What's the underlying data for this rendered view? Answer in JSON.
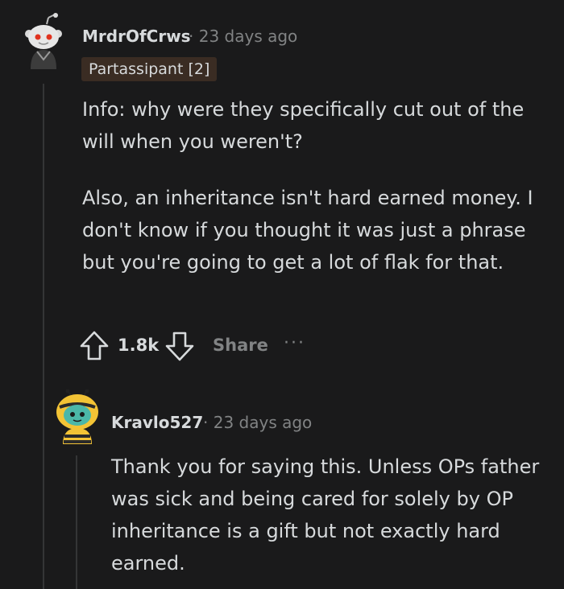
{
  "comment": {
    "username": "MrdrOfCrws",
    "separator": "·",
    "time": "23 days ago",
    "flair": "Partassipant [2]",
    "paragraphs": [
      "Info: why were they specifically cut out of the will when you weren't?",
      "Also, an inheritance isn't hard earned money. I don't know if you thought it was just a phrase but you're going to get a lot of flak for that."
    ],
    "votes": "1.8k",
    "share_label": "Share",
    "more_label": "···",
    "icons": {
      "avatar": "snoo-avatar-icon",
      "upvote": "upvote-arrow-icon",
      "downvote": "downvote-arrow-icon",
      "more": "more-options-icon"
    }
  },
  "reply": {
    "username": "Kravlo527",
    "separator": "·",
    "time": "23 days ago",
    "paragraphs": [
      "Thank you for saying this. Unless OPs father was sick and being cared for solely by OP inheritance is a gift but not exactly hard earned."
    ],
    "icons": {
      "avatar": "bee-costume-snoo-avatar-icon"
    }
  },
  "colors": {
    "background": "#1a1a1b",
    "text": "#d7dadc",
    "meta": "#818384",
    "flair_background": "#3a2c23",
    "thread_line": "#343536"
  }
}
